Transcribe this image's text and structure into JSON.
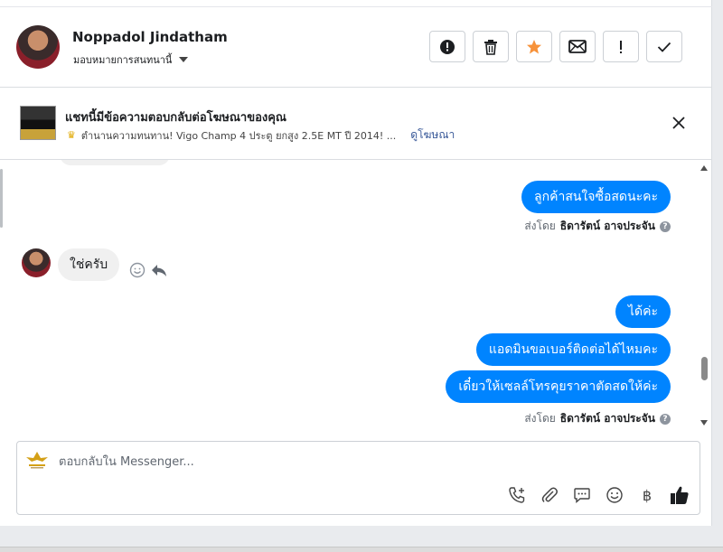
{
  "header": {
    "contact_name": "Noppadol Jindatham",
    "assign_label": "มอบหมายการสนทนานี้",
    "actions": [
      {
        "name": "report-spam-button",
        "icon": "exclamation-circle-icon"
      },
      {
        "name": "delete-button",
        "icon": "trash-icon"
      },
      {
        "name": "star-button",
        "icon": "star-icon"
      },
      {
        "name": "mark-unread-button",
        "icon": "envelope-icon"
      },
      {
        "name": "follow-up-button",
        "icon": "exclamation-icon"
      },
      {
        "name": "mark-done-button",
        "icon": "check-icon"
      }
    ],
    "star_color": "#f7923a"
  },
  "ad_banner": {
    "title": "แชทนี้มีข้อความตอบกลับต่อโฆษณาของคุณ",
    "ad_text": "ตำนานความทนทาน! Vigo Champ 4 ประตู ยกสูง 2.5E MT ปี 2014! ...",
    "link_label": "ดูโฆษณา"
  },
  "messages": {
    "out_1": "ลูกค้าสนใจซื้อสดนะคะ",
    "sent_by_prefix": "ส่งโดย",
    "sent_by_name": "ธิดารัตน์ อาจประจัน",
    "in_1": "ใช่ครับ",
    "out_2": "ได้ค่ะ",
    "out_3": "แอดมินขอเบอร์ติดต่อได้ไหมคะ",
    "out_4": "เดี๋ยวให้เซลล์โทรคุยราคาตัดสดให้ค่ะ",
    "bubble_color": "#0084ff"
  },
  "composer": {
    "placeholder": "ตอบกลับใน Messenger...",
    "currency_symbol": "฿"
  }
}
